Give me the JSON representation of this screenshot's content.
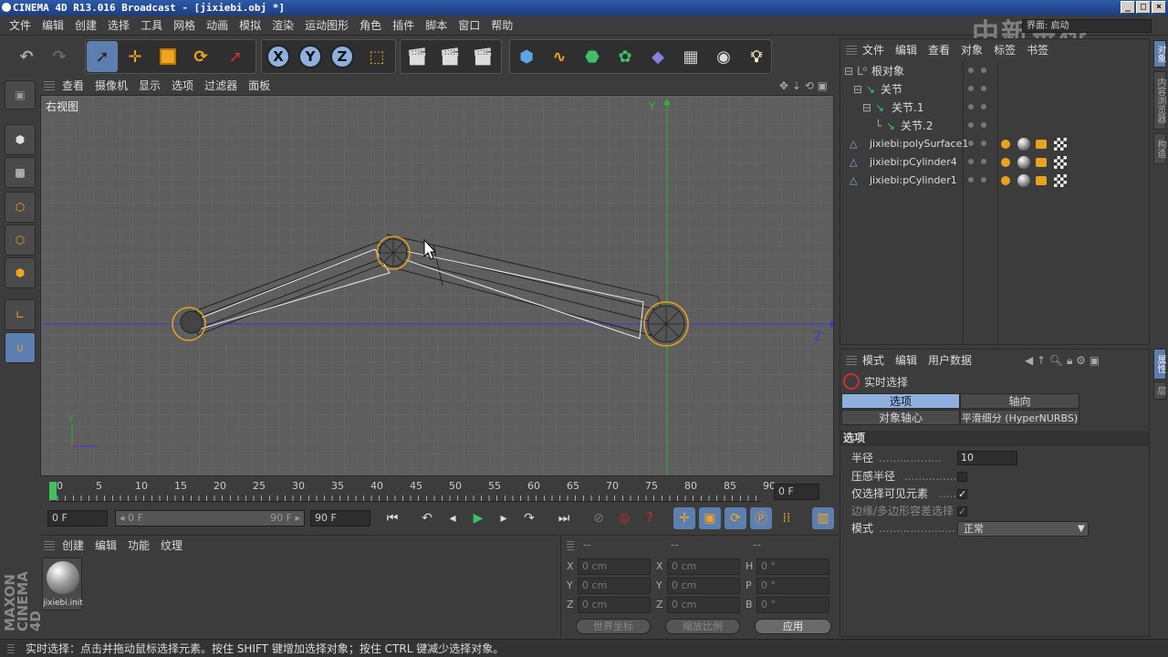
{
  "window": {
    "title": "CINEMA 4D R13.016 Broadcast - [jixiebi.obj *]",
    "min": "_",
    "max": "□",
    "close": "×"
  },
  "menubar": [
    "文件",
    "编辑",
    "创建",
    "选择",
    "工具",
    "网格",
    "动画",
    "模拟",
    "渲染",
    "运动图形",
    "角色",
    "插件",
    "脚本",
    "窗口",
    "帮助"
  ],
  "watermark": "中新金桥",
  "layout_label": "界面: 启动",
  "viewport": {
    "menu": [
      "查看",
      "摄像机",
      "显示",
      "选项",
      "过滤器",
      "面板"
    ],
    "label": "右视图",
    "axis_y": "Y",
    "axis_z": "Z",
    "gizmo_y": "Y"
  },
  "timeline": {
    "ticks": [
      "0",
      "5",
      "10",
      "15",
      "20",
      "25",
      "30",
      "35",
      "40",
      "45",
      "50",
      "55",
      "60",
      "65",
      "70",
      "75",
      "80",
      "85",
      "90"
    ],
    "current_frame": "0 F"
  },
  "controls": {
    "start": "0 F",
    "range_start": "◂ 0 F",
    "range_end": "90 F ▸",
    "end": "90 F"
  },
  "material_panel": {
    "menu": [
      "创建",
      "编辑",
      "功能",
      "纹理"
    ],
    "material_name": "jixiebi.init"
  },
  "coord_panel": {
    "headers": [
      "--",
      "--",
      "--"
    ],
    "rows": [
      {
        "k1": "X",
        "v1": "0 cm",
        "k2": "X",
        "v2": "0 cm",
        "k3": "H",
        "v3": "0 °"
      },
      {
        "k1": "Y",
        "v1": "0 cm",
        "k2": "Y",
        "v2": "0 cm",
        "k3": "P",
        "v3": "0 °"
      },
      {
        "k1": "Z",
        "v1": "0 cm",
        "k2": "Z",
        "v2": "0 cm",
        "k3": "B",
        "v3": "0 °"
      }
    ],
    "world": "世界坐标",
    "scale": "缩放比例",
    "apply": "应用"
  },
  "object_manager": {
    "menu": [
      "文件",
      "编辑",
      "查看",
      "对象",
      "标签",
      "书签"
    ],
    "items": [
      {
        "name": "根对象",
        "indent": 0
      },
      {
        "name": "关节",
        "indent": 1
      },
      {
        "name": "关节.1",
        "indent": 2
      },
      {
        "name": "关节.2",
        "indent": 3
      },
      {
        "name": "jixiebi:polySurface1",
        "indent": 0
      },
      {
        "name": "jixiebi:pCylinder4",
        "indent": 0
      },
      {
        "name": "jixiebi:pCylinder1",
        "indent": 0
      }
    ]
  },
  "attribute_manager": {
    "menu": [
      "模式",
      "编辑",
      "用户数据"
    ],
    "tool_name": "实时选择",
    "tabs": [
      "选项",
      "轴向",
      "对象轴心",
      "平滑细分 (HyperNURBS)"
    ],
    "section": "选项",
    "fields": [
      {
        "label": "半径",
        "value": "10"
      },
      {
        "label": "压感半径",
        "checked": ""
      },
      {
        "label": "仅选择可见元素",
        "checked": "✓"
      },
      {
        "label": "边缘/多边形容差选择",
        "checked": "✓"
      },
      {
        "label": "模式",
        "value": "正常"
      }
    ]
  },
  "right_tabs": [
    "对象",
    "内容浏览器",
    "构造",
    "属性",
    "层"
  ],
  "brand": "MAXON CINEMA 4D",
  "status": "实时选择：点击并拖动鼠标选择元素。按住 SHIFT 键增加选择对象；按住 CTRL 键减少选择对象。",
  "colors": {
    "accent": "#5d7fb0",
    "viewport_bg": "#5e5e5e",
    "axis_y": "#2fb32f",
    "axis_z": "#3b3bd0",
    "joint": "#e8a21c"
  }
}
